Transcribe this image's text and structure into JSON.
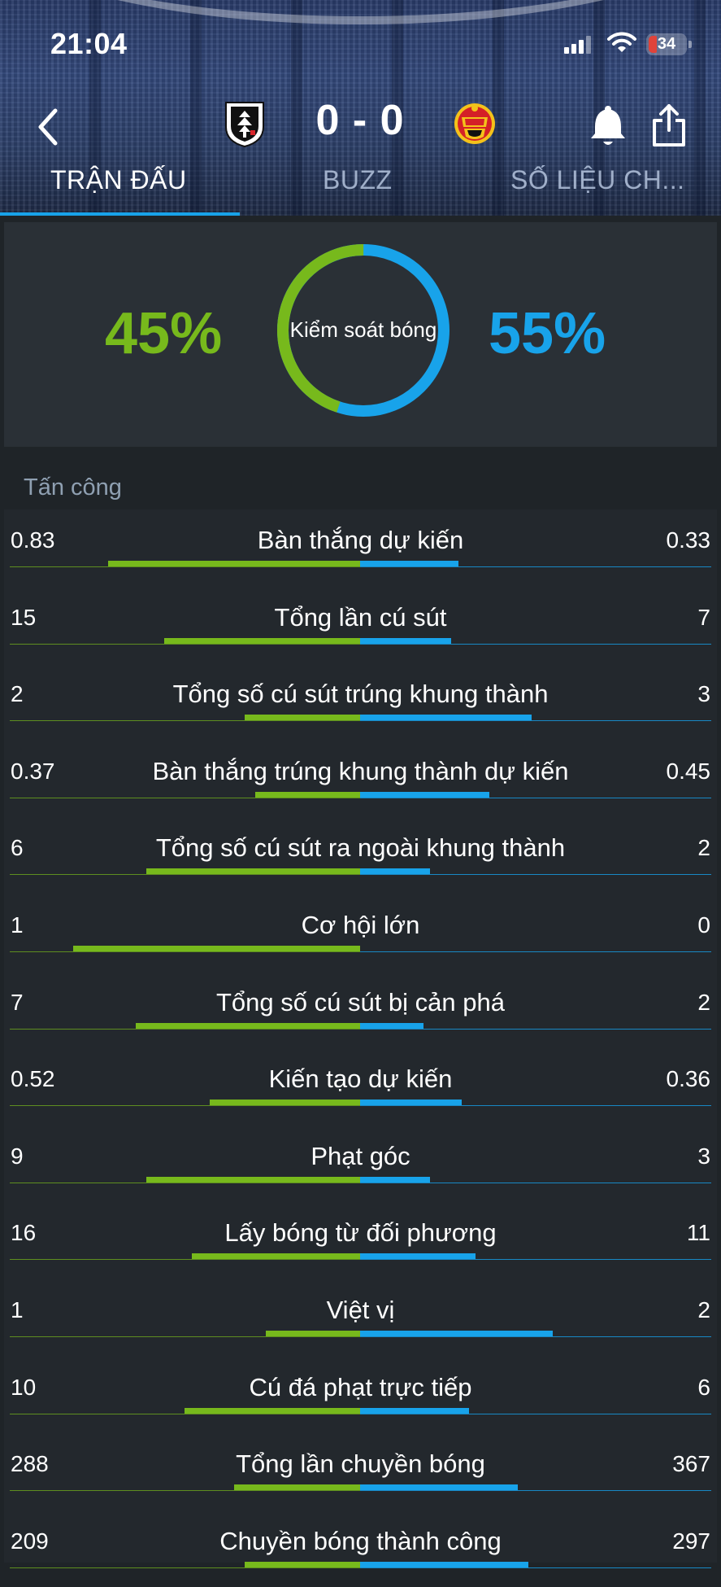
{
  "status_bar": {
    "time": "21:04",
    "battery": "34"
  },
  "match": {
    "score": "0 - 0"
  },
  "tabs": [
    {
      "label": "TRẬN ĐẤU",
      "active": true
    },
    {
      "label": "BUZZ",
      "active": false
    },
    {
      "label": "SỐ LIỆU CH...",
      "active": false
    }
  ],
  "possession": {
    "label": "Kiểm soát bóng",
    "home_text": "45%",
    "away_text": "55%",
    "home": 45,
    "away": 55
  },
  "colors": {
    "home": "#77b91c",
    "away": "#18a3ea",
    "background": "#1f2428"
  },
  "icons": [
    "chevron-left-icon",
    "fulham-crest-icon",
    "manchester-united-crest-icon",
    "bell-icon",
    "share-icon",
    "signal-icon",
    "wifi-icon",
    "battery-icon"
  ],
  "section": {
    "title": "Tấn công",
    "stats": [
      {
        "label": "Bàn thắng dự kiến",
        "home": "0.83",
        "away": "0.33",
        "home_share": 0.72,
        "away_share": 0.28
      },
      {
        "label": "Tổng lần cú sút",
        "home": "15",
        "away": "7",
        "home_share": 0.56,
        "away_share": 0.26
      },
      {
        "label": "Tổng số cú sút trúng khung thành",
        "home": "2",
        "away": "3",
        "home_share": 0.33,
        "away_share": 0.49
      },
      {
        "label": "Bàn thắng trúng khung thành dự kiến",
        "home": "0.37",
        "away": "0.45",
        "home_share": 0.3,
        "away_share": 0.37
      },
      {
        "label": "Tổng số cú sút ra ngoài khung thành",
        "home": "6",
        "away": "2",
        "home_share": 0.61,
        "away_share": 0.2
      },
      {
        "label": "Cơ hội lớn",
        "home": "1",
        "away": "0",
        "home_share": 0.82,
        "away_share": 0.0
      },
      {
        "label": "Tổng số cú sút bị cản phá",
        "home": "7",
        "away": "2",
        "home_share": 0.64,
        "away_share": 0.18
      },
      {
        "label": "Kiến tạo dự kiến",
        "home": "0.52",
        "away": "0.36",
        "home_share": 0.43,
        "away_share": 0.29
      },
      {
        "label": "Phạt góc",
        "home": "9",
        "away": "3",
        "home_share": 0.61,
        "away_share": 0.2
      },
      {
        "label": "Lấy bóng từ đối phương",
        "home": "16",
        "away": "11",
        "home_share": 0.48,
        "away_share": 0.33
      },
      {
        "label": "Việt vị",
        "home": "1",
        "away": "2",
        "home_share": 0.27,
        "away_share": 0.55
      },
      {
        "label": "Cú đá phạt trực tiếp",
        "home": "10",
        "away": "6",
        "home_share": 0.5,
        "away_share": 0.31
      },
      {
        "label": "Tổng lần chuyền bóng",
        "home": "288",
        "away": "367",
        "home_share": 0.36,
        "away_share": 0.45
      },
      {
        "label": "Chuyền bóng thành công",
        "home": "209",
        "away": "297",
        "home_share": 0.33,
        "away_share": 0.48
      }
    ]
  }
}
